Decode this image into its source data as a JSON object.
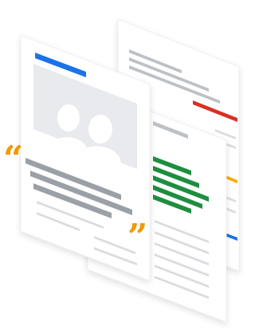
{
  "illustration": {
    "description_name": "stacked-documents-with-quote",
    "colors": {
      "blue": "#1a73e8",
      "red": "#d93025",
      "green": "#1e8e3e",
      "yellow": "#f9ab00",
      "quote": "#f29900",
      "photo_bg": "#e8eaed",
      "silhouette": "#ffffff",
      "text_dark": "#9aa0a6",
      "text_light": "#dadce0",
      "page": "#ffffff",
      "page_edge": "#f1f3f4"
    },
    "quote_marks": {
      "open": "“",
      "close": "”"
    }
  }
}
